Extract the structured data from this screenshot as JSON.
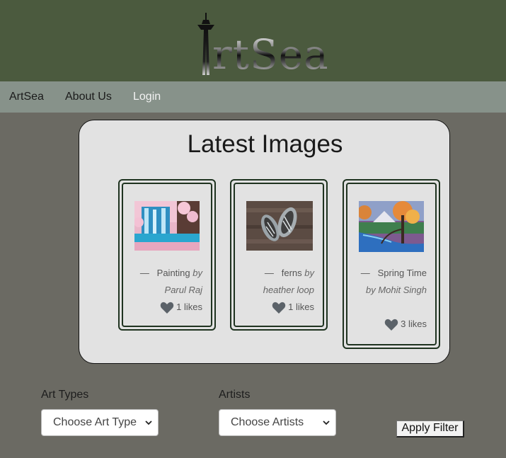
{
  "header": {
    "logo_text": "rtSea"
  },
  "nav": {
    "items": [
      "ArtSea",
      "About Us",
      "Login"
    ]
  },
  "latest": {
    "title": "Latest Images",
    "cards": [
      {
        "dash": "—",
        "title": "Painting",
        "by": "by",
        "artist": "Parul Raj",
        "likes": "1 likes"
      },
      {
        "dash": "—",
        "title": "ferns",
        "by": "by",
        "artist": "heather loop",
        "likes": "1 likes"
      },
      {
        "dash": "—",
        "title": "Spring Time",
        "by": "by",
        "artist": "Mohit Singh",
        "likes": "3 likes"
      }
    ]
  },
  "filters": {
    "art_types_label": "Art Types",
    "art_type_value": "Choose Art Type",
    "artists_label": "Artists",
    "artists_value": "Choose Artists",
    "apply_label": "Apply Filter"
  }
}
